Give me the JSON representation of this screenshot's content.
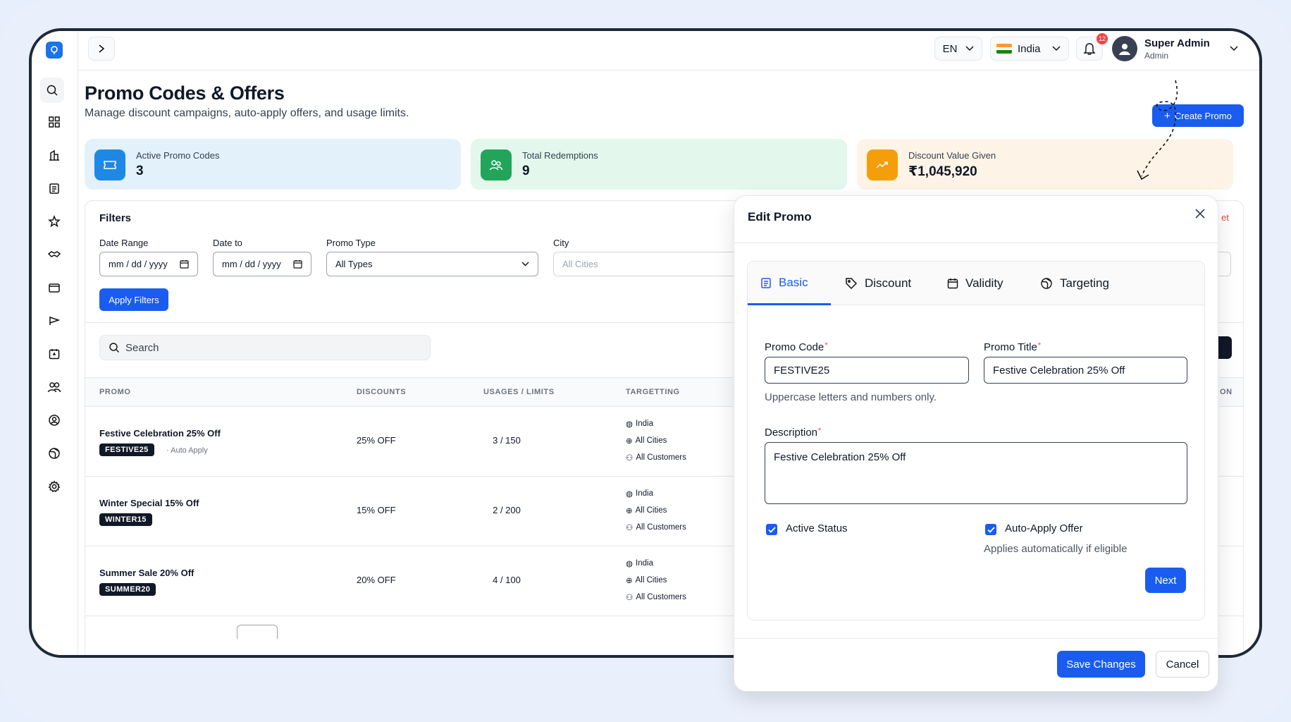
{
  "topbar": {
    "language": "EN",
    "country": "India",
    "notification_count": "12",
    "user_name": "Super Admin",
    "user_role": "Admin"
  },
  "header": {
    "title": "Promo Codes & Offers",
    "subtitle": "Manage discount campaigns, auto-apply offers, and usage limits.",
    "create_label": "Create Promo"
  },
  "stats": [
    {
      "label": "Active Promo Codes",
      "value": "3",
      "color": "#1e88e5",
      "bg": "#e3f1fb"
    },
    {
      "label": "Total Redemptions",
      "value": "9",
      "color": "#22a55a",
      "bg": "#e3f7ec"
    },
    {
      "label": "Discount Value Given",
      "value": "₹1,045,920",
      "color": "#f59e0b",
      "bg": "#fdf3e6"
    }
  ],
  "filters": {
    "title": "Filters",
    "date_range_label": "Date Range",
    "date_to_label": "Date to",
    "promo_type_label": "Promo Type",
    "city_label": "City",
    "date_placeholder": "mm / dd / yyyy",
    "promo_type_value": "All Types",
    "city_placeholder": "All Cities",
    "apply_label": "Apply Filters",
    "reset_partial": "et"
  },
  "search": {
    "placeholder": "Search"
  },
  "table": {
    "headers": [
      "PROMO",
      "DISCOUNTS",
      "USAGES / LIMITS",
      "TARGETTING",
      "ON"
    ],
    "rows": [
      {
        "title": "Festive Celebration 25% Off",
        "code": "FESTIVE25",
        "auto": "· Auto Apply",
        "discount": "25% OFF",
        "usage": "3 / 150",
        "country": "India",
        "cities": "All Cities",
        "customers": "All Customers"
      },
      {
        "title": "Winter Special 15% Off",
        "code": "WINTER15",
        "auto": "",
        "discount": "15% OFF",
        "usage": "2 / 200",
        "country": "India",
        "cities": "All Cities",
        "customers": "All Customers"
      },
      {
        "title": "Summer Sale 20% Off",
        "code": "SUMMER20",
        "auto": "",
        "discount": "20% OFF",
        "usage": "4 / 100",
        "country": "India",
        "cities": "All Cities",
        "customers": "All Customers"
      }
    ]
  },
  "modal": {
    "title": "Edit Promo",
    "tabs": [
      "Basic",
      "Discount",
      "Validity",
      "Targeting"
    ],
    "promo_code_label": "Promo Code",
    "promo_code_value": "FESTIVE25",
    "promo_code_hint": "Uppercase letters and numbers only.",
    "promo_title_label": "Promo Title",
    "promo_title_value": "Festive Celebration 25% Off",
    "description_label": "Description",
    "description_value": "Festive Celebration 25% Off",
    "active_status_label": "Active Status",
    "auto_apply_label": "Auto-Apply Offer",
    "auto_apply_hint": "Applies automatically if eligible",
    "next_label": "Next",
    "save_label": "Save Changes",
    "cancel_label": "Cancel"
  }
}
